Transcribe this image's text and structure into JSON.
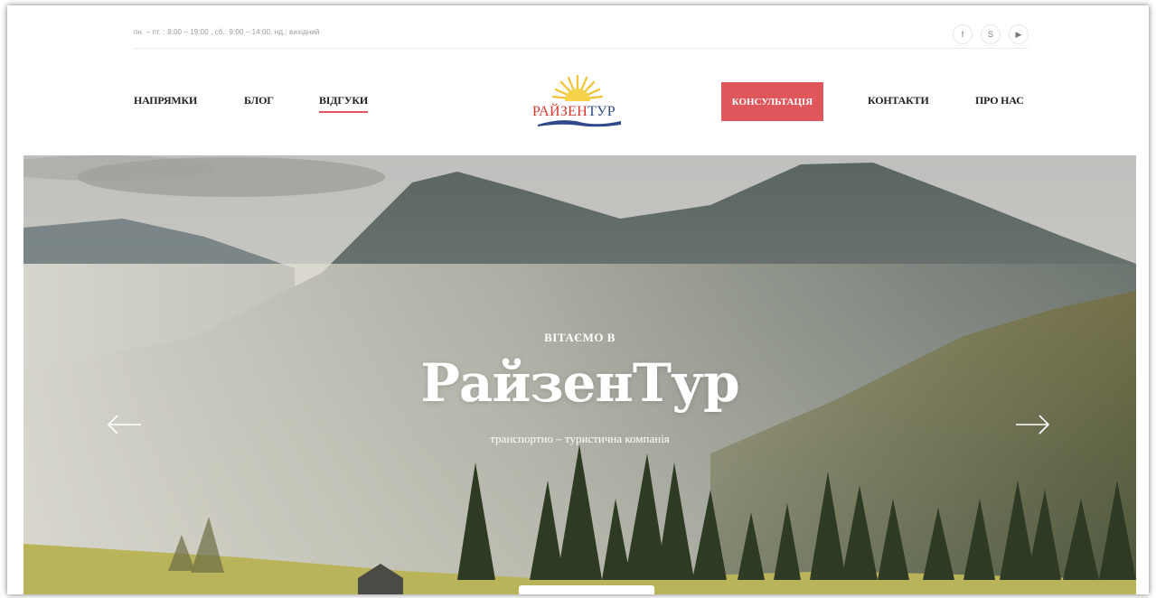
{
  "topbar": {
    "hours": "пн. – пт. : 9:00 – 19:00 , сб.: 9:00 – 14:00, нд.: вихідний",
    "socials": [
      {
        "icon": "facebook-icon",
        "glyph": "f"
      },
      {
        "icon": "skype-icon",
        "glyph": "S"
      },
      {
        "icon": "youtube-icon",
        "glyph": "▶"
      }
    ]
  },
  "nav": {
    "left": [
      "НАПРЯМКИ",
      "БЛОГ",
      "ВІДГУКИ"
    ],
    "consult": "КОНСУЛЬТАЦІЯ",
    "right": [
      "КОНТАКТИ",
      "ПРО НАС"
    ],
    "active": "ВІДГУКИ"
  },
  "logo": {
    "part1": "РАЙЗЕН",
    "part2": "ТУР",
    "colors": {
      "red": "#d43a2f",
      "blue": "#2e4a8a",
      "sun": "#f2c230"
    }
  },
  "hero": {
    "subtitle": "ВІТАЄМО В",
    "title": "РайзенТур",
    "tagline": "транспортно – туристична компанія"
  },
  "colors": {
    "accent": "#e0575b"
  }
}
